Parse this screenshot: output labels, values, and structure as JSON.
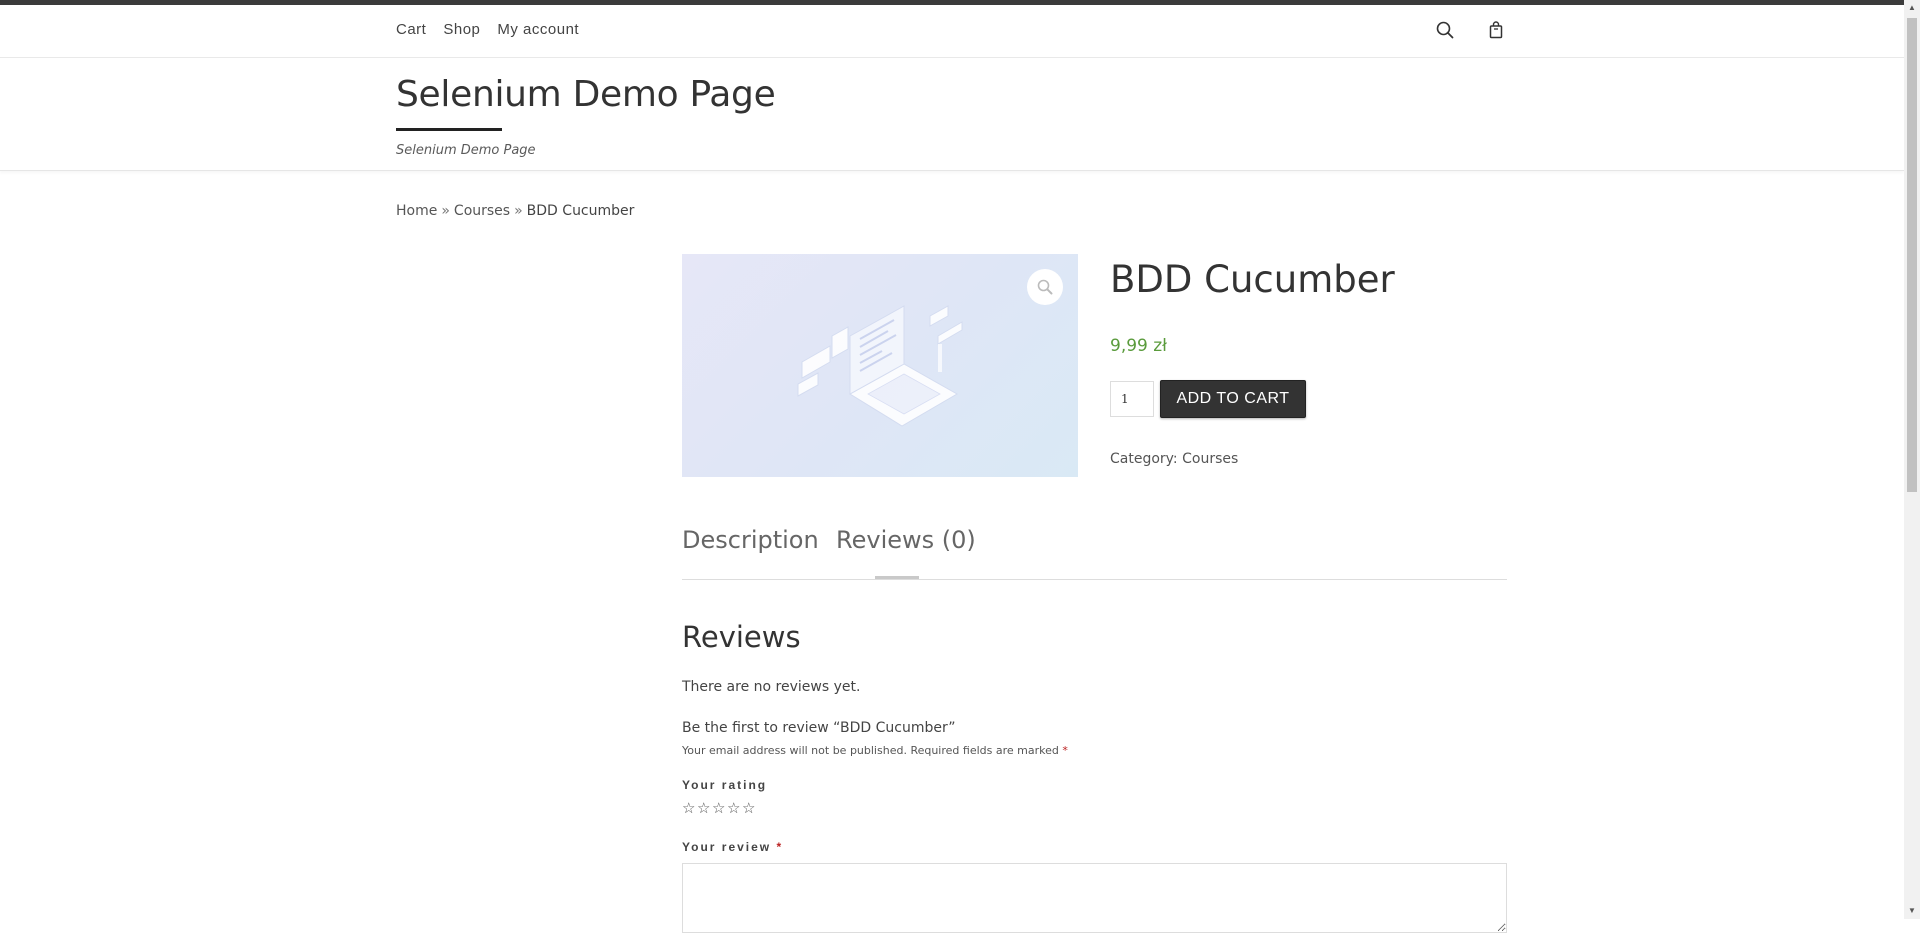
{
  "nav": {
    "items": [
      "Cart",
      "Shop",
      "My account"
    ]
  },
  "header": {
    "site_title": "Selenium Demo Page",
    "tagline": "Selenium Demo Page"
  },
  "breadcrumb": {
    "home": "Home",
    "sep1": "»",
    "category": "Courses",
    "sep2": "»",
    "current": "BDD Cucumber"
  },
  "product": {
    "title": "BDD Cucumber",
    "price": "9,99 zł",
    "quantity": "1",
    "add_to_cart": "ADD TO CART",
    "category_label": "Category:",
    "category_value": "Courses"
  },
  "tabs": {
    "description": "Description",
    "reviews": "Reviews (0)"
  },
  "reviews": {
    "title": "Reviews",
    "empty": "There are no reviews yet.",
    "first_review": "Be the first to review “BDD Cucumber”",
    "notes": "Your email address will not be published. Required fields are marked",
    "required_mark": "*",
    "rating_label": "Your rating",
    "review_label": "Your review",
    "stars": [
      "☆",
      "☆",
      "☆",
      "☆",
      "☆"
    ]
  },
  "colors": {
    "price": "#5a9b3c",
    "button_bg": "#333333",
    "top_bar": "#3b3b3b"
  },
  "icons": [
    "search-icon",
    "shopping-bag-icon",
    "zoom-icon",
    "star-icon"
  ]
}
